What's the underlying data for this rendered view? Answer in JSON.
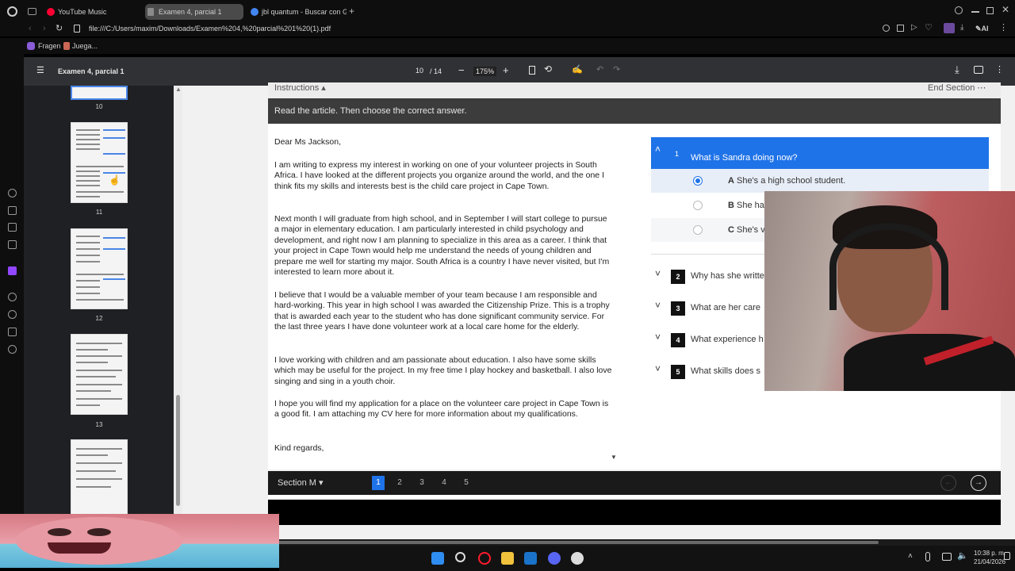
{
  "browser": {
    "tabs": [
      {
        "label": "YouTube Music",
        "color": "#ff0033"
      },
      {
        "label": "Examen 4, parcial 1",
        "color": "#8a8a8a"
      },
      {
        "label": "jbl quantum - Buscar con G",
        "color": "#4285f4"
      }
    ],
    "url": "file:///C:/Users/maxim/Downloads/Examen%204,%20parcial%201%20(1).pdf",
    "bookmarks": [
      "Fragen",
      "Juega..."
    ],
    "ai_label": "AI"
  },
  "pdf": {
    "title": "Examen 4, parcial 1",
    "page_current": "10",
    "page_total": "/ 14",
    "zoom": "175%",
    "thumb_numbers": [
      "10",
      "11",
      "12",
      "13"
    ]
  },
  "exam": {
    "instructions_tab": "Instructions",
    "end_section": "End Section",
    "instruction_text": "Read the article. Then choose the correct answer.",
    "letter": [
      "Dear Ms Jackson,",
      "I am writing to express my interest in working on one of your volunteer projects in South Africa. I have looked at the different projects you organize around the world, and the one I think fits my skills and interests best is the child care project in Cape Town.",
      "Next month I will graduate from high school, and in September I will start college to pursue a major in elementary education. I am particularly interested in child psychology and development, and right now I am planning to specialize in this area as a career. I think that your project in Cape Town would help me understand the needs of young children and prepare me well for starting my major. South Africa is a country I have never visited, but I'm interested to learn more about it.",
      "I believe that I would be a valuable member of your team because I am responsible and hard-working. This year in high school I was awarded the Citizenship Prize. This is a trophy that is awarded each year to the student who has done significant community service. For the last three years I have done volunteer work at a local care home for the elderly.",
      "I love working with children and am passionate about education. I also have some skills which may be useful for the project. In my free time I play hockey and basketball. I also love singing and sing in a youth choir.",
      "I hope you will find my application for a place on the volunteer care project in Cape Town is a good fit. I am attaching my CV here for more information about my qualifications.",
      "Kind regards,"
    ],
    "q1": {
      "num": "1",
      "text": "What is Sandra doing now?"
    },
    "options": [
      {
        "letter": "A",
        "text": "She's a high school student.",
        "selected": true
      },
      {
        "letter": "B",
        "text": "She ha",
        "selected": false
      },
      {
        "letter": "C",
        "text": "She's v",
        "selected": false
      }
    ],
    "questions": [
      {
        "num": "2",
        "text": "Why has she writte"
      },
      {
        "num": "3",
        "text": "What are her care"
      },
      {
        "num": "4",
        "text": "What experience h"
      },
      {
        "num": "5",
        "text": "What skills does s"
      }
    ],
    "section_label": "Section M",
    "pages": [
      "1",
      "2",
      "3",
      "4",
      "5"
    ],
    "active_page": "1"
  },
  "taskbar": {
    "time": "10:38 p. m.",
    "date": "21/04/2026"
  },
  "colors": {
    "accent": "#1f73e8",
    "pdf_toolbar": "#303134"
  }
}
